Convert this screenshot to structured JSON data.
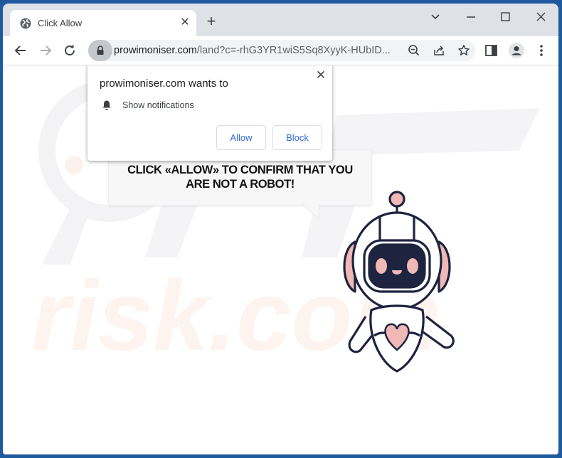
{
  "browser": {
    "tab": {
      "title": "Click Allow",
      "icon": "globe-icon"
    },
    "new_tab_label": "+",
    "window_controls": [
      "chevron-down-icon",
      "minimize-icon",
      "maximize-icon",
      "close-icon"
    ],
    "address_bar": {
      "domain": "prowimoniser.com",
      "path": "/land?c=-rhG3YR1wiS5Sq8XyyK-HUbID..."
    }
  },
  "permission_prompt": {
    "title": "prowimoniser.com wants to",
    "permission": "Show notifications",
    "allow_label": "Allow",
    "block_label": "Block",
    "close_label": "✕"
  },
  "page": {
    "bubble_line1": "CLICK «ALLOW» TO CONFIRM THAT YOU",
    "bubble_line2": "ARE NOT A ROBOT!",
    "watermark_text": "risk.com"
  },
  "colors": {
    "frame": "#1f5a9e",
    "robot_outline": "#1e2340",
    "robot_pink": "#f0b9b6",
    "button_text": "#3367d6"
  }
}
